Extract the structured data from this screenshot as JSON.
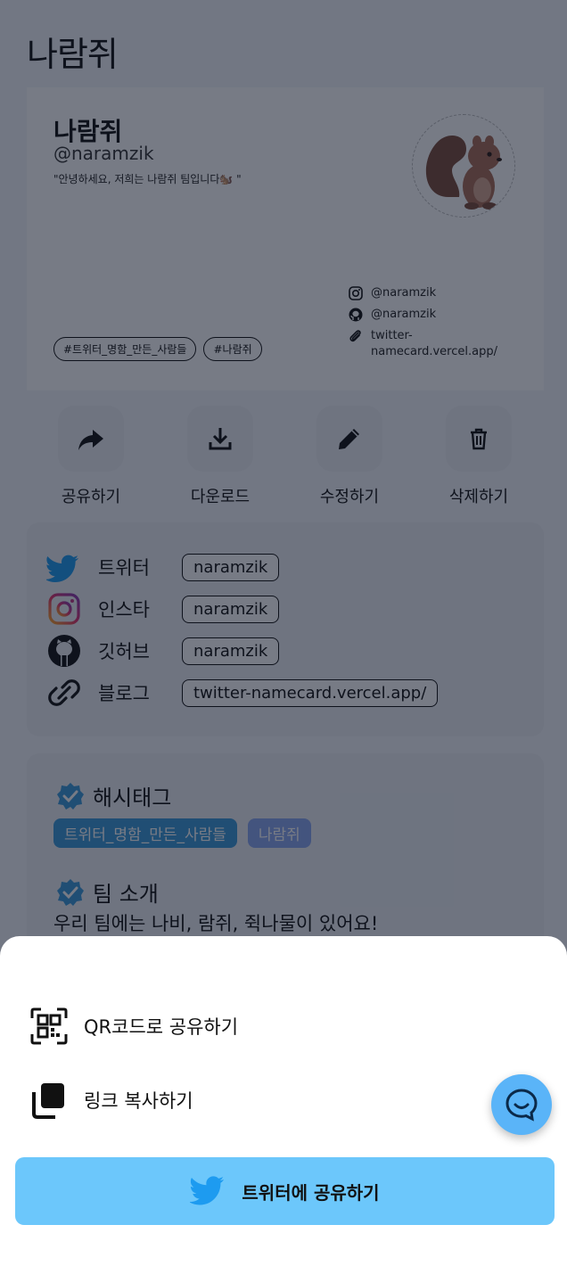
{
  "app": {
    "title": "나람쥐"
  },
  "card": {
    "name": "나람쥐",
    "handle": "@naramzik",
    "bio": "\"안녕하세요, 저희는 나람쥐 팀입니다🐿️ \"",
    "tags": [
      "#트위터_명함_만든_사람들",
      "#나람쥐"
    ],
    "links": [
      {
        "icon": "instagram-icon",
        "text": "@naramzik"
      },
      {
        "icon": "github-icon",
        "text": "@naramzik"
      },
      {
        "icon": "paperclip-icon",
        "text": "twitter-namecard.vercel.app/"
      }
    ]
  },
  "actions": [
    {
      "icon": "share-icon",
      "label": "공유하기"
    },
    {
      "icon": "download-icon",
      "label": "다운로드"
    },
    {
      "icon": "edit-icon",
      "label": "수정하기"
    },
    {
      "icon": "trash-icon",
      "label": "삭제하기"
    }
  ],
  "sns": [
    {
      "icon": "twitter-icon",
      "name": "트위터",
      "value": "naramzik"
    },
    {
      "icon": "instagram-icon",
      "name": "인스타",
      "value": "naramzik"
    },
    {
      "icon": "github-icon",
      "name": "깃허브",
      "value": "naramzik"
    },
    {
      "icon": "link-icon",
      "name": "블로그",
      "value": "twitter-namecard.vercel.app/"
    }
  ],
  "info": {
    "hashtag_title": "해시태그",
    "hashtags": [
      "트위터_명함_만든_사람들",
      "나람쥐"
    ],
    "team_title": "팀 소개",
    "team_text": "우리 팀에는 나비, 람쥐, 쥑나물이 있어요!"
  },
  "sheet": {
    "qr_label": "QR코드로 공유하기",
    "copy_label": "링크 복사하기",
    "twitter_label": "트위터에 공유하기"
  },
  "colors": {
    "overlay": "#0c1426",
    "twitter_button": "#6cc7fb",
    "chat_fab": "#5ab4f8",
    "hashtag_primary": "#3a98d8",
    "hashtag_secondary": "#8aa6f0"
  }
}
